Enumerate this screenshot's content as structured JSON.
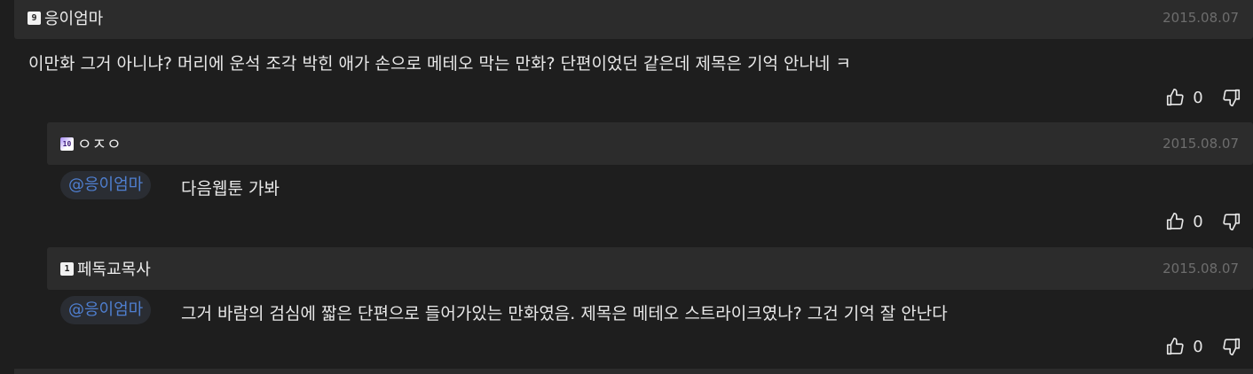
{
  "comments": [
    {
      "author": "응이엄마",
      "badge": "9",
      "date": "2015.08.07",
      "text": "이만화 그거 아니냐? 머리에 운석 조각 박힌 애가 손으로 메테오 막는 만화? 단편이었던 같은데 제목은 기억 안나네 ㅋ",
      "likes": "0"
    },
    {
      "author": "ㅇㅈㅇ",
      "badge": "10",
      "date": "2015.08.07",
      "mention": "@응이엄마",
      "text": "다음웹툰 가봐",
      "likes": "0"
    },
    {
      "author": "페독교목사",
      "badge": "1",
      "date": "2015.08.07",
      "mention": "@응이엄마",
      "text": "그거 바람의 검심에 짧은 단편으로 들어가있는 만화였음. 제목은 메테오 스트라이크였나? 그건 기억 잘 안난다",
      "likes": "0"
    }
  ],
  "colors": {
    "background": "#1e1e1e",
    "header": "#2c2c2c",
    "mention": "#4f7fd0",
    "date": "#6d6d6d"
  },
  "icons": {
    "like": "thumbs-up-icon",
    "dislike": "thumbs-down-icon"
  }
}
